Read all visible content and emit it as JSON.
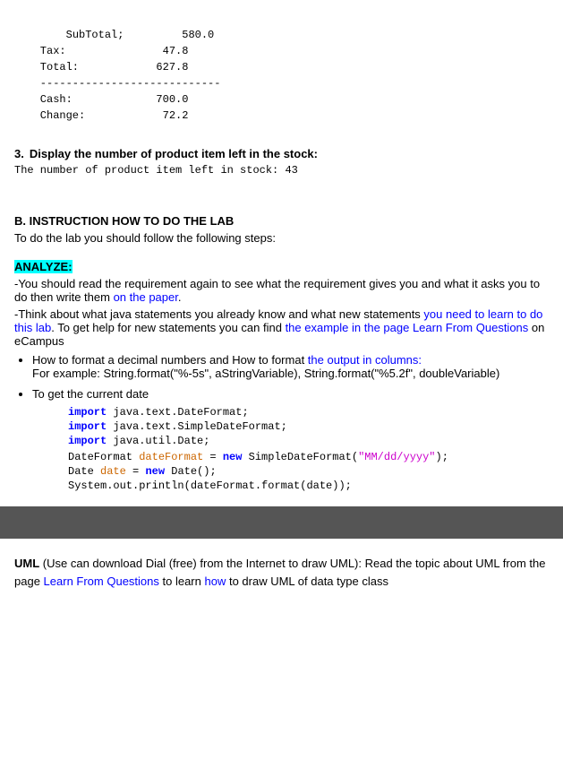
{
  "receipt": {
    "subtotal_label": "SubTotal;",
    "subtotal_value": "580.0",
    "tax_label": "Tax:",
    "tax_value": "47.8",
    "total_label": "Total:",
    "total_value": "627.8",
    "cash_label": "Cash:",
    "cash_value": "700.0",
    "change_label": "Change:",
    "change_value": "72.2"
  },
  "section3": {
    "number": "3.",
    "label": "Display the number of product item left in the stock:",
    "code": "The number of product item left in stock: 43"
  },
  "sectionB": {
    "title": "B. INSTRUCTION HOW TO DO THE LAB",
    "intro": "To do the lab you should follow the following steps:"
  },
  "analyze": {
    "label": "ANALYZE:",
    "line1": "-You should read the requirement again to see what the requirement gives you and what it asks you to do then write them on the paper.",
    "line2": "-Think about what java statements you already know and what new statements you need to learn to do this lab. To get help for new statements you can find the example in the page Learn From Questions on eCampus"
  },
  "bullets": [
    {
      "main": "How to format a decimal numbers and How to format the output in columns:",
      "sub": "For example:  String.format(\"%-5s\", aStringVariable), String.format(\"%5.2f\", doubleVariable)"
    },
    {
      "main": "To get the current date",
      "code_lines": [
        {
          "prefix": "import",
          "kw": "import",
          "rest": " java.text.DateFormat;"
        },
        {
          "prefix": "import",
          "kw": "import",
          "rest": " java.text.SimpleDateFormat;"
        },
        {
          "prefix": "import",
          "kw": "import",
          "rest": " java.util.Date;"
        },
        {
          "prefix": "dateformat_line",
          "text": "DateFormat ",
          "var": "dateFormat",
          "op": " = ",
          "kw_new": "new",
          "cls": " SimpleDateFormat(",
          "str": "\"MM/dd/yyyy\"",
          "end": ");"
        },
        {
          "prefix": "date_line",
          "text": "Date ",
          "var": "date",
          "op": " = ",
          "kw_new": "new",
          "cls": " Date();"
        },
        {
          "prefix": "println_line",
          "text": "System.out.println(dateFormat.format(date));"
        }
      ]
    }
  ],
  "uml": {
    "label": "UML",
    "text": "(Use can download Dial (free) from the Internet to draw UML): Read the topic about UML from the page Learn From Questions to learn how to draw UML of data type class"
  }
}
